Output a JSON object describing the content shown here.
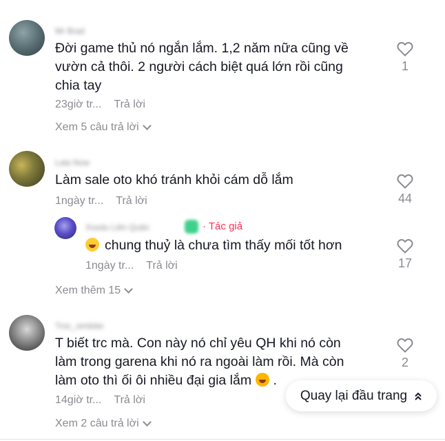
{
  "comments": [
    {
      "username": "Mr Brad",
      "text_lines": [
        "Đời game thủ nó ngắn lắm. 1,2 năm nữa cũng về",
        "vườn cả thôi. 2 người cách biệt quá lớn rồi cũng",
        "chia tay"
      ],
      "time": "23giờ tr...",
      "reply_label": "Trả lời",
      "likes": "1",
      "view_more": "Xem 5 câu trả lời"
    },
    {
      "username": "Lala Now",
      "text": "Làm sale oto khó tránh khỏi cám dỗ lắm",
      "time": "1ngày tr...",
      "reply_label": "Trả lời",
      "likes": "44",
      "view_more": "Xem thêm 15",
      "reply": {
        "username": "Xoxdu Liên Quân",
        "author_badge": "· Tác giả",
        "text": "chung thuỷ là chưa tìm thấy mối tốt hơn",
        "time": "1ngày tr...",
        "reply_label": "Trả lời",
        "likes": "17"
      }
    },
    {
      "username": "Trúc_simbiiie",
      "text_lines": [
        "T biết trc mà. Con này nó chỉ yêu QH khi nó còn",
        "làm trong garena khi nó ra ngoài làm rồi. Mà còn",
        "làm oto thì ối ôi nhiều đại gia lắm"
      ],
      "time": "14giờ tr...",
      "reply_label": "Trả lời",
      "likes": "2",
      "view_more": "Xem 2 câu trả lời"
    }
  ],
  "back_to_top": {
    "label": "Quay lại đầu trang",
    "icon": "double-chevron-up-icon"
  },
  "colors": {
    "text": "#161823",
    "muted": "#8a8b91",
    "author": "#fe2c55"
  }
}
